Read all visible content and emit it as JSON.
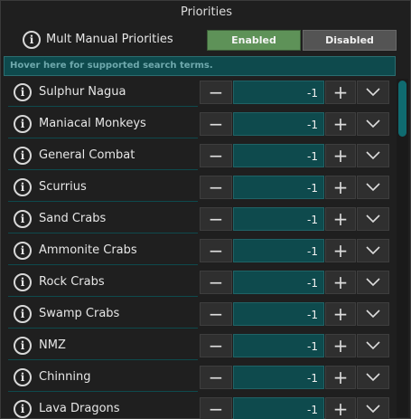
{
  "header": {
    "title": "Priorities"
  },
  "toggle": {
    "label": "Mult Manual Priorities",
    "enabled_label": "Enabled",
    "disabled_label": "Disabled",
    "active": "Enabled"
  },
  "search": {
    "placeholder": "Hover here for supported search terms."
  },
  "rows": [
    {
      "label": "Sulphur Nagua",
      "value": "-1"
    },
    {
      "label": "Maniacal Monkeys",
      "value": "-1"
    },
    {
      "label": "General Combat",
      "value": "-1"
    },
    {
      "label": "Scurrius",
      "value": "-1"
    },
    {
      "label": "Sand Crabs",
      "value": "-1"
    },
    {
      "label": "Ammonite Crabs",
      "value": "-1"
    },
    {
      "label": "Rock Crabs",
      "value": "-1"
    },
    {
      "label": "Swamp Crabs",
      "value": "-1"
    },
    {
      "label": "NMZ",
      "value": "-1"
    },
    {
      "label": "Chinning",
      "value": "-1"
    },
    {
      "label": "Lava Dragons",
      "value": "-1"
    }
  ],
  "icons": {
    "info": "info-icon",
    "minus": "minus-icon",
    "plus": "plus-icon",
    "dropdown": "chevron-down-icon"
  },
  "colors": {
    "accent_teal": "#0e4a4d",
    "enabled_green": "#5e9258",
    "disabled_gray": "#545454",
    "scroll_thumb": "#0f6b70"
  }
}
